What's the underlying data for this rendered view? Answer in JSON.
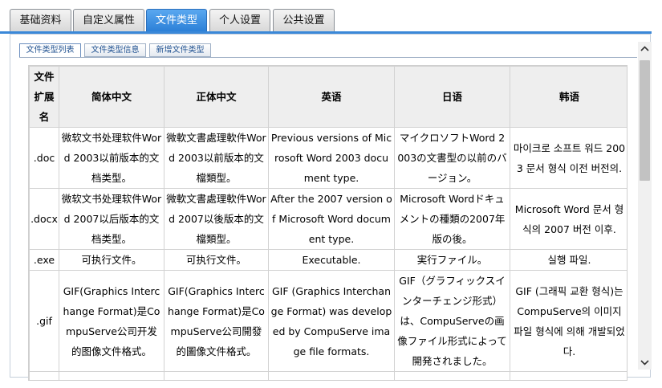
{
  "top_tabs": [
    {
      "label": "基础资料",
      "active": false
    },
    {
      "label": "自定义属性",
      "active": false
    },
    {
      "label": "文件类型",
      "active": true
    },
    {
      "label": "个人设置",
      "active": false
    },
    {
      "label": "公共设置",
      "active": false
    }
  ],
  "sub_tabs": [
    {
      "label": "文件类型列表",
      "active": true
    },
    {
      "label": "文件类型信息",
      "active": false
    },
    {
      "label": "新增文件类型",
      "active": false
    }
  ],
  "table": {
    "headers": [
      "文件扩展名",
      "简体中文",
      "正体中文",
      "英语",
      "日语",
      "韩语"
    ],
    "rows": [
      [
        ".doc",
        "微软文书处理软件Word 2003以前版本的文档类型。",
        "微軟文書處理軟件Word 2003以前版本的文檔類型。",
        "Previous versions of Microsoft Word 2003 document type.",
        "マイクロソフトWord 2003の文書型の以前のバージョン。",
        "마이크로 소프트 워드 2003 문서 형식 이전 버전의."
      ],
      [
        ".docx",
        "微软文书处理软件Word 2007以后版本的文档类型。",
        "微軟文書處理軟件Word 2007以後版本的文檔類型。",
        "After the 2007 version of Microsoft Word document type.",
        "Microsoft Wordドキュメントの種類の2007年版の後。",
        "Microsoft Word 문서 형식의 2007 버전 이후."
      ],
      [
        ".exe",
        "可执行文件。",
        "可执行文件。",
        "Executable.",
        "実行ファイル。",
        "실행 파일."
      ],
      [
        ".gif",
        "GIF(Graphics Interchange Format)是CompuServe公司开发的图像文件格式。",
        "GIF(Graphics Interchange Format)是CompuServe公司開發的圖像文件格式。",
        "GIF (Graphics Interchange Format) was developed by CompuServe image file formats.",
        "GIF（グラフィックスインターチェンジ形式）は、CompuServeの画像ファイル形式によって開発されました。",
        "GIF (그래픽 교환 형식)는 CompuServe의 이미지 파일 형식에 의해 개발되었다."
      ]
    ]
  },
  "icons": {
    "scroll_up": "chevron-up-icon",
    "scroll_down": "chevron-down-icon"
  },
  "colors": {
    "active_tab": "#2a7ed6",
    "accent_line": "#3a88d8"
  }
}
